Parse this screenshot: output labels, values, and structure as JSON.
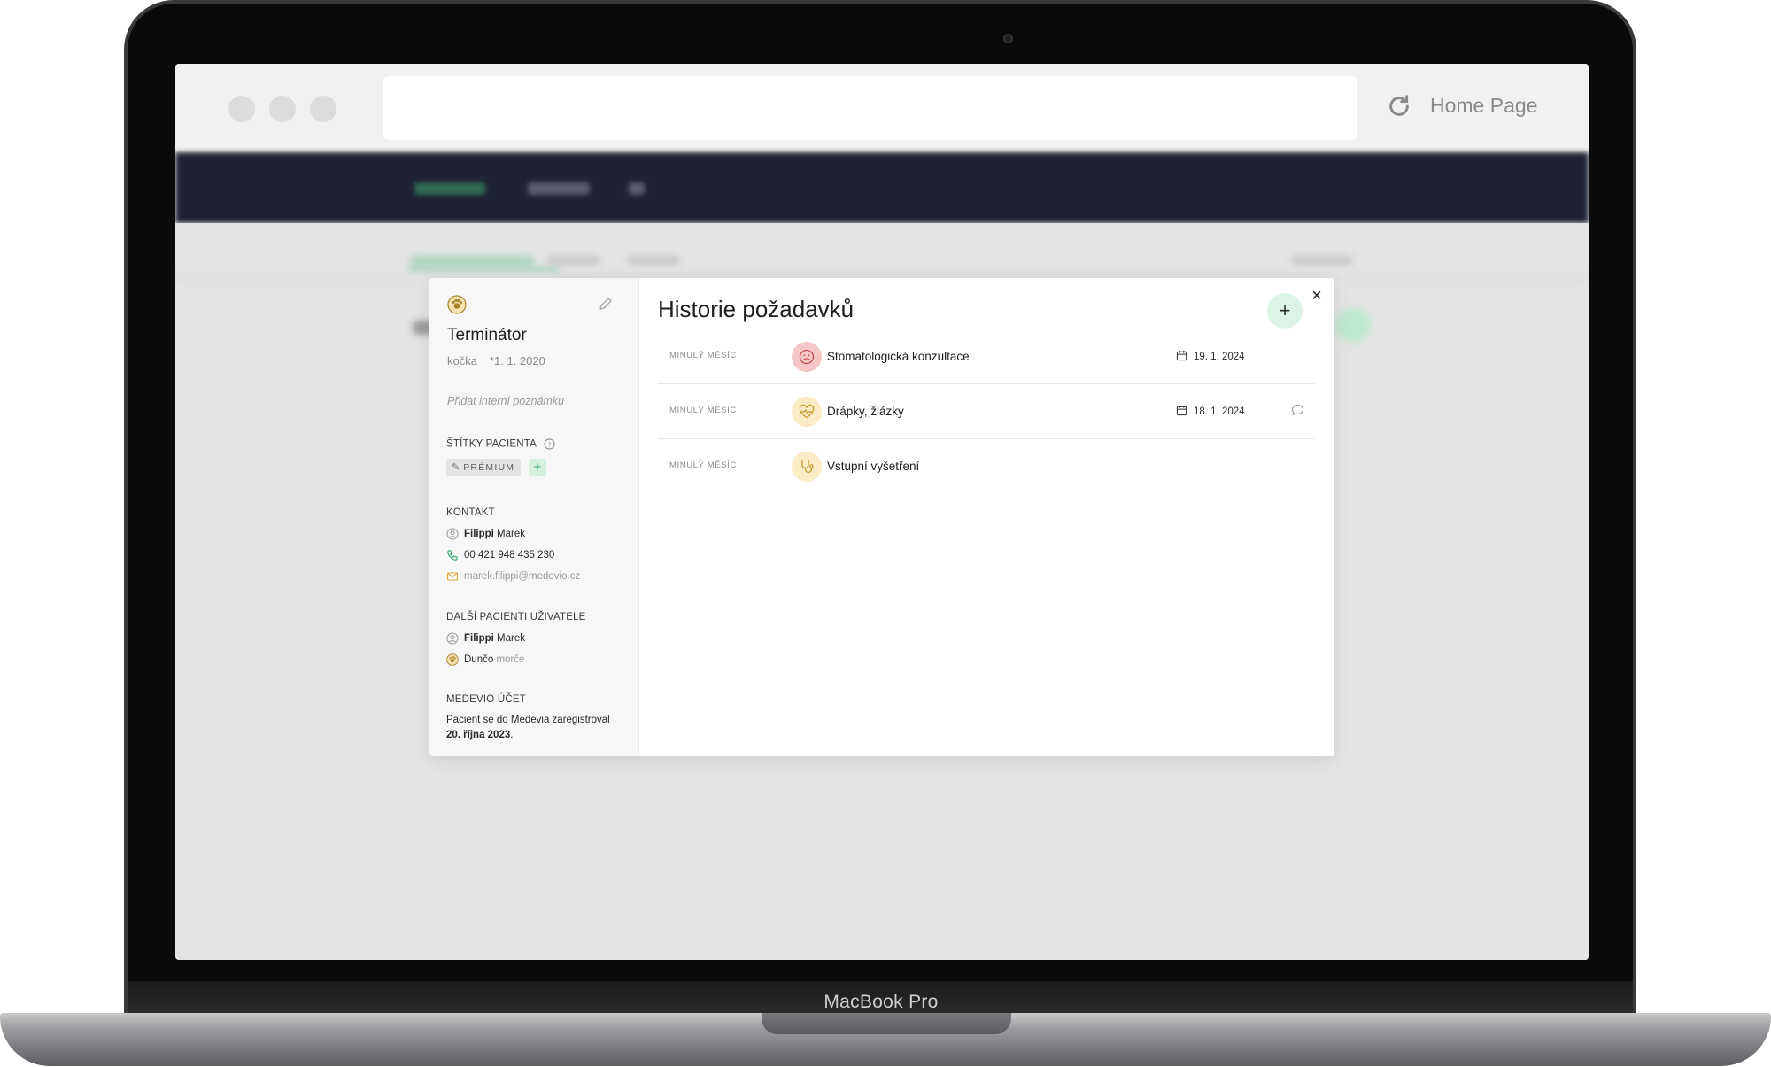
{
  "device": {
    "model_label": "MacBook Pro"
  },
  "browser": {
    "home_label": "Home Page",
    "url_value": ""
  },
  "colors": {
    "accent_green": "#dcf4e6",
    "app_nav": "#1e2233",
    "badge_red": "#f5c7c7",
    "badge_yellow": "#fbecc6"
  },
  "patient": {
    "name": "Terminátor",
    "species": "kočka",
    "birth": "*1. 1. 2020",
    "icon": "pet-icon",
    "add_note": "Přidat interní poznámku",
    "tags_title": "ŠTÍTKY PACIENTA",
    "tags": [
      "PRÉMIUM"
    ],
    "tag_add_symbol": "+"
  },
  "contact": {
    "title": "KONTAKT",
    "owner_first": "Filippi",
    "owner_last": " Marek",
    "phone": "00 421 948 435 230",
    "email": "marek.filippi@medevio.cz"
  },
  "other_patients": {
    "title": "DALŠÍ PACIENTI UŽIVATELE",
    "items": [
      {
        "name_bold": "Filippi",
        "name_rest": " Marek",
        "type": ""
      },
      {
        "name_bold": "",
        "name_rest": "Dunčo",
        "type": " morče"
      }
    ]
  },
  "account": {
    "title": "MEDEVIO ÚČET",
    "text_prefix": "Pacient se do Medevia zaregistroval",
    "date_bold": "20. října 2023",
    "text_suffix": "."
  },
  "history": {
    "title": "Historie požadavků",
    "add_symbol": "+",
    "close_symbol": "×",
    "requests": [
      {
        "when": "MINULÝ MĚSÍC",
        "name": "Stomatologická konzultace",
        "date": "19. 1. 2024",
        "icon": "dental-icon",
        "comment": false
      },
      {
        "when": "MINULÝ MĚSÍC",
        "name": "Drápky, žlázky",
        "date": "18. 1. 2024",
        "icon": "heartbeat-icon",
        "comment": true
      },
      {
        "when": "MINULÝ MĚSÍC",
        "name": "Vstupní vyšetření",
        "date": "",
        "icon": "stethoscope-icon",
        "comment": false
      }
    ]
  }
}
